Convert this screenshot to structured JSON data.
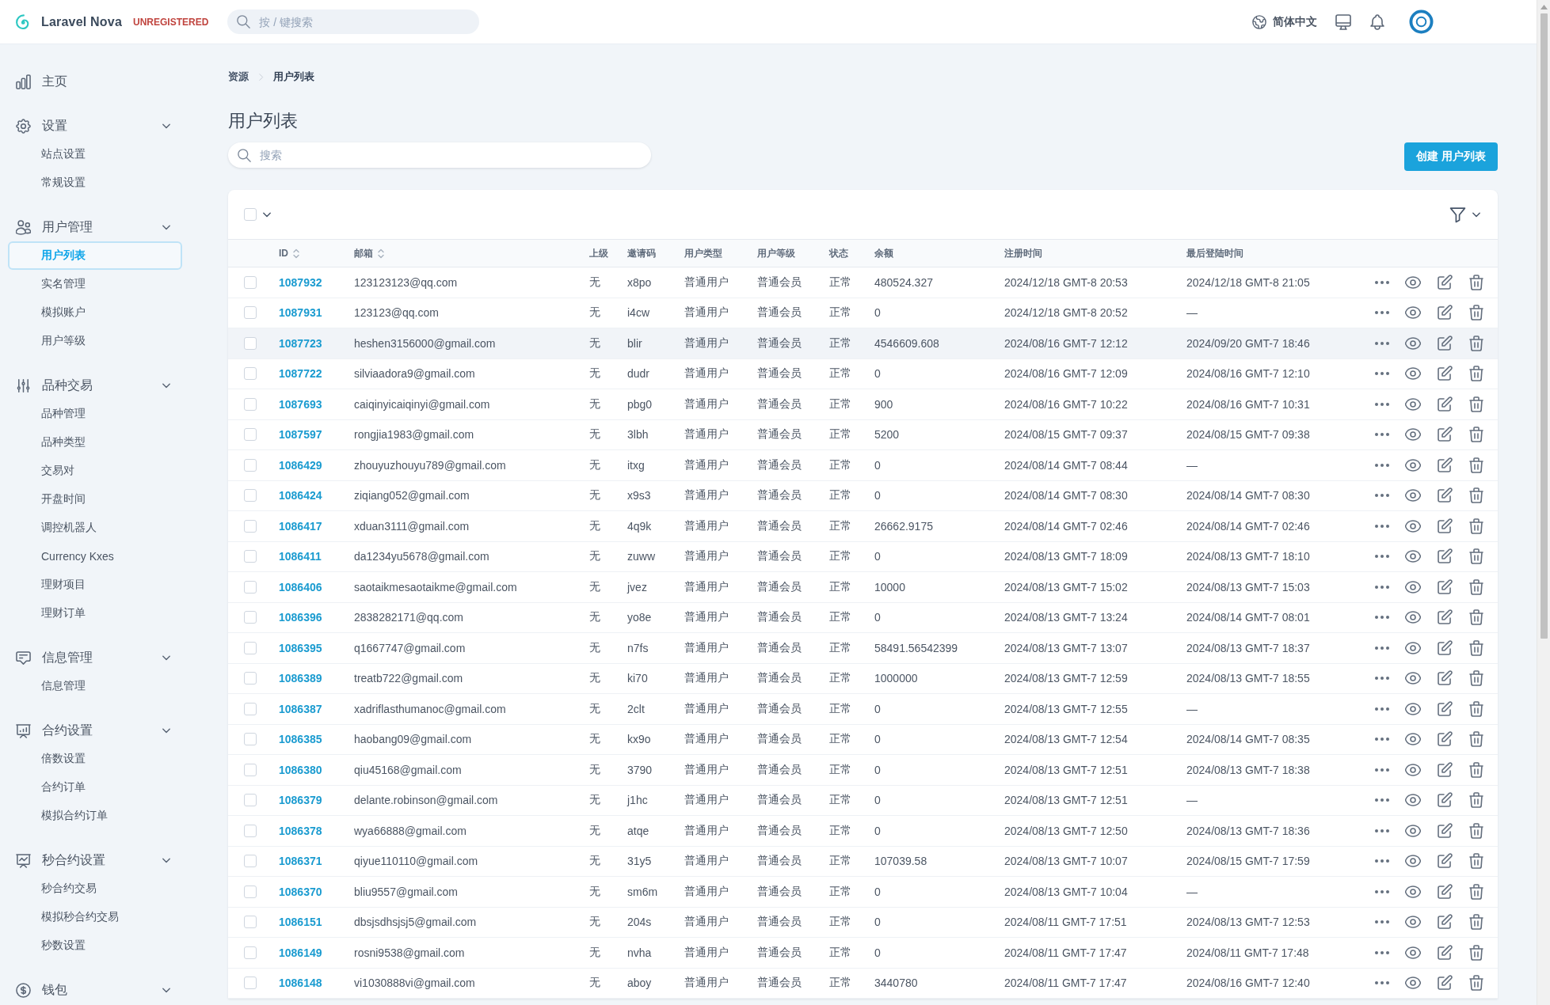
{
  "topbar": {
    "brand": "Laravel Nova",
    "license": "UNREGISTERED",
    "search": {
      "placeholder": "按 / 键搜索"
    },
    "language": "简体中文"
  },
  "sidebar": {
    "items": [
      {
        "kind": "link",
        "label": "主页",
        "selected": false
      },
      {
        "kind": "group",
        "label": "设置",
        "children": [
          {
            "label": "站点设置",
            "selected": false
          },
          {
            "label": "常规设置",
            "selected": false
          }
        ]
      },
      {
        "kind": "group",
        "label": "用户管理",
        "children": [
          {
            "label": "用户列表",
            "selected": true
          },
          {
            "label": "实名管理",
            "selected": false
          },
          {
            "label": "模拟账户",
            "selected": false
          },
          {
            "label": "用户等级",
            "selected": false
          }
        ]
      },
      {
        "kind": "group",
        "label": "品种交易",
        "children": [
          {
            "label": "品种管理",
            "selected": false
          },
          {
            "label": "品种类型",
            "selected": false
          },
          {
            "label": "交易对",
            "selected": false
          },
          {
            "label": "开盘时间",
            "selected": false
          },
          {
            "label": "调控机器人",
            "selected": false
          },
          {
            "label": "Currency Kxes",
            "selected": false
          },
          {
            "label": "理财项目",
            "selected": false
          },
          {
            "label": "理财订单",
            "selected": false
          }
        ]
      },
      {
        "kind": "group",
        "label": "信息管理",
        "children": [
          {
            "label": "信息管理",
            "selected": false
          }
        ]
      },
      {
        "kind": "group",
        "label": "合约设置",
        "children": [
          {
            "label": "倍数设置",
            "selected": false
          },
          {
            "label": "合约订单",
            "selected": false
          },
          {
            "label": "模拟合约订单",
            "selected": false
          }
        ]
      },
      {
        "kind": "group",
        "label": "秒合约设置",
        "children": [
          {
            "label": "秒合约交易",
            "selected": false
          },
          {
            "label": "模拟秒合约交易",
            "selected": false
          },
          {
            "label": "秒数设置",
            "selected": false
          }
        ]
      },
      {
        "kind": "group",
        "label": "钱包"
      }
    ]
  },
  "breadcrumb": [
    "资源",
    "用户列表"
  ],
  "title": "用户列表",
  "search": {
    "placeholder": "搜索"
  },
  "create_button": "创建 用户列表",
  "table": {
    "select_all": {
      "checked": false
    },
    "columns": [
      {
        "label": "ID",
        "sortable": true
      },
      {
        "label": "邮箱",
        "sortable": true
      },
      {
        "label": "上级",
        "sortable": false
      },
      {
        "label": "邀请码",
        "sortable": false
      },
      {
        "label": "用户类型",
        "sortable": false
      },
      {
        "label": "用户等级",
        "sortable": false
      },
      {
        "label": "状态",
        "sortable": false
      },
      {
        "label": "余额",
        "sortable": false
      },
      {
        "label": "注册时间",
        "sortable": false
      },
      {
        "label": "最后登陆时间",
        "sortable": false
      }
    ],
    "rows": [
      {
        "cells": [
          "1087932",
          "123123123@qq.com",
          "无",
          "x8po",
          "普通用户",
          "普通会员",
          "正常",
          "480524.327",
          "2024/12/18 GMT-8 20:53",
          "2024/12/18 GMT-8 21:05"
        ],
        "checked": false,
        "highlighted": false
      },
      {
        "cells": [
          "1087931",
          "123123@qq.com",
          "无",
          "i4cw",
          "普通用户",
          "普通会员",
          "正常",
          "0",
          "2024/12/18 GMT-8 20:52",
          "—"
        ],
        "checked": false,
        "highlighted": false
      },
      {
        "cells": [
          "1087723",
          "heshen3156000@gmail.com",
          "无",
          "blir",
          "普通用户",
          "普通会员",
          "正常",
          "4546609.608",
          "2024/08/16 GMT-7 12:12",
          "2024/09/20 GMT-7 18:46"
        ],
        "checked": false,
        "highlighted": true
      },
      {
        "cells": [
          "1087722",
          "silviaadora9@gmail.com",
          "无",
          "dudr",
          "普通用户",
          "普通会员",
          "正常",
          "0",
          "2024/08/16 GMT-7 12:09",
          "2024/08/16 GMT-7 12:10"
        ],
        "checked": false,
        "highlighted": false
      },
      {
        "cells": [
          "1087693",
          "caiqinyicaiqinyi@gmail.com",
          "无",
          "pbg0",
          "普通用户",
          "普通会员",
          "正常",
          "900",
          "2024/08/16 GMT-7 10:22",
          "2024/08/16 GMT-7 10:31"
        ],
        "checked": false,
        "highlighted": false
      },
      {
        "cells": [
          "1087597",
          "rongjia1983@gmail.com",
          "无",
          "3lbh",
          "普通用户",
          "普通会员",
          "正常",
          "5200",
          "2024/08/15 GMT-7 09:37",
          "2024/08/15 GMT-7 09:38"
        ],
        "checked": false,
        "highlighted": false
      },
      {
        "cells": [
          "1086429",
          "zhouyuzhouyu789@gmail.com",
          "无",
          "itxg",
          "普通用户",
          "普通会员",
          "正常",
          "0",
          "2024/08/14 GMT-7 08:44",
          "—"
        ],
        "checked": false,
        "highlighted": false
      },
      {
        "cells": [
          "1086424",
          "ziqiang052@gmail.com",
          "无",
          "x9s3",
          "普通用户",
          "普通会员",
          "正常",
          "0",
          "2024/08/14 GMT-7 08:30",
          "2024/08/14 GMT-7 08:30"
        ],
        "checked": false,
        "highlighted": false
      },
      {
        "cells": [
          "1086417",
          "xduan3111@gmail.com",
          "无",
          "4q9k",
          "普通用户",
          "普通会员",
          "正常",
          "26662.9175",
          "2024/08/14 GMT-7 02:46",
          "2024/08/14 GMT-7 02:46"
        ],
        "checked": false,
        "highlighted": false
      },
      {
        "cells": [
          "1086411",
          "da1234yu5678@gmail.com",
          "无",
          "zuww",
          "普通用户",
          "普通会员",
          "正常",
          "0",
          "2024/08/13 GMT-7 18:09",
          "2024/08/13 GMT-7 18:10"
        ],
        "checked": false,
        "highlighted": false
      },
      {
        "cells": [
          "1086406",
          "saotaikmesaotaikme@gmail.com",
          "无",
          "jvez",
          "普通用户",
          "普通会员",
          "正常",
          "10000",
          "2024/08/13 GMT-7 15:02",
          "2024/08/13 GMT-7 15:03"
        ],
        "checked": false,
        "highlighted": false
      },
      {
        "cells": [
          "1086396",
          "2838282171@qq.com",
          "无",
          "yo8e",
          "普通用户",
          "普通会员",
          "正常",
          "0",
          "2024/08/13 GMT-7 13:24",
          "2024/08/14 GMT-7 08:01"
        ],
        "checked": false,
        "highlighted": false
      },
      {
        "cells": [
          "1086395",
          "q1667747@gmail.com",
          "无",
          "n7fs",
          "普通用户",
          "普通会员",
          "正常",
          "58491.56542399",
          "2024/08/13 GMT-7 13:07",
          "2024/08/13 GMT-7 18:37"
        ],
        "checked": false,
        "highlighted": false
      },
      {
        "cells": [
          "1086389",
          "treatb722@gmail.com",
          "无",
          "ki70",
          "普通用户",
          "普通会员",
          "正常",
          "1000000",
          "2024/08/13 GMT-7 12:59",
          "2024/08/13 GMT-7 18:55"
        ],
        "checked": false,
        "highlighted": false
      },
      {
        "cells": [
          "1086387",
          "xadriflasthumanoc@gmail.com",
          "无",
          "2clt",
          "普通用户",
          "普通会员",
          "正常",
          "0",
          "2024/08/13 GMT-7 12:55",
          "—"
        ],
        "checked": false,
        "highlighted": false
      },
      {
        "cells": [
          "1086385",
          "haobang09@gmail.com",
          "无",
          "kx9o",
          "普通用户",
          "普通会员",
          "正常",
          "0",
          "2024/08/13 GMT-7 12:54",
          "2024/08/14 GMT-7 08:35"
        ],
        "checked": false,
        "highlighted": false
      },
      {
        "cells": [
          "1086380",
          "qiu45168@gmail.com",
          "无",
          "3790",
          "普通用户",
          "普通会员",
          "正常",
          "0",
          "2024/08/13 GMT-7 12:51",
          "2024/08/13 GMT-7 18:38"
        ],
        "checked": false,
        "highlighted": false
      },
      {
        "cells": [
          "1086379",
          "delante.robinson@gmail.com",
          "无",
          "j1hc",
          "普通用户",
          "普通会员",
          "正常",
          "0",
          "2024/08/13 GMT-7 12:51",
          "—"
        ],
        "checked": false,
        "highlighted": false
      },
      {
        "cells": [
          "1086378",
          "wya66888@gmail.com",
          "无",
          "atqe",
          "普通用户",
          "普通会员",
          "正常",
          "0",
          "2024/08/13 GMT-7 12:50",
          "2024/08/13 GMT-7 18:36"
        ],
        "checked": false,
        "highlighted": false
      },
      {
        "cells": [
          "1086371",
          "qiyue110110@gmail.com",
          "无",
          "31y5",
          "普通用户",
          "普通会员",
          "正常",
          "107039.58",
          "2024/08/13 GMT-7 10:07",
          "2024/08/15 GMT-7 17:59"
        ],
        "checked": false,
        "highlighted": false
      },
      {
        "cells": [
          "1086370",
          "bliu9557@gmail.com",
          "无",
          "sm6m",
          "普通用户",
          "普通会员",
          "正常",
          "0",
          "2024/08/13 GMT-7 10:04",
          "—"
        ],
        "checked": false,
        "highlighted": false
      },
      {
        "cells": [
          "1086151",
          "dbsjsdhsjsj5@gmail.com",
          "无",
          "204s",
          "普通用户",
          "普通会员",
          "正常",
          "0",
          "2024/08/11 GMT-7 17:51",
          "2024/08/13 GMT-7 12:53"
        ],
        "checked": false,
        "highlighted": false
      },
      {
        "cells": [
          "1086149",
          "rosni9538@gmail.com",
          "无",
          "nvha",
          "普通用户",
          "普通会员",
          "正常",
          "0",
          "2024/08/11 GMT-7 17:47",
          "2024/08/11 GMT-7 17:48"
        ],
        "checked": false,
        "highlighted": false
      },
      {
        "cells": [
          "1086148",
          "vi1030888vi@gmail.com",
          "无",
          "aboy",
          "普通用户",
          "普通会员",
          "正常",
          "3440780",
          "2024/08/11 GMT-7 17:47",
          "2024/08/16 GMT-7 12:40"
        ],
        "checked": false,
        "highlighted": false
      }
    ]
  }
}
